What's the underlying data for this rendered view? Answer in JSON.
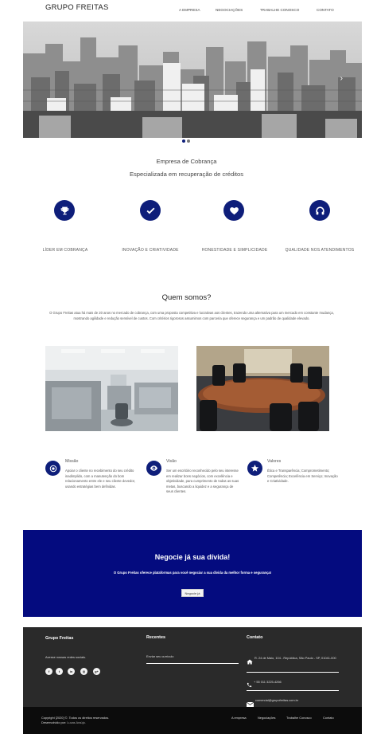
{
  "header": {
    "brand": "GRUPO FREITAS",
    "nav": [
      "A EMPRESA",
      "NEGOCIAÇÕES",
      "TRABALHE CONOSCO",
      "CONTATO"
    ]
  },
  "hero": {
    "alt": "city-skyline-photo"
  },
  "intro": {
    "line1": "Empresa de Cobrança",
    "line2": "Especializada em recuperação de créditos"
  },
  "features": [
    {
      "icon": "trophy-icon",
      "label": "LÍDER EM COBRANÇA"
    },
    {
      "icon": "check-icon",
      "label": "INOVAÇÃO E CRIATIVIDADE"
    },
    {
      "icon": "heart-icon",
      "label": "HONESTIDADE E SIMPLICIDADE"
    },
    {
      "icon": "headset-icon",
      "label": "QUALIDADE NOS ATENDIMENTOS"
    }
  ],
  "about": {
    "title": "Quem somos?",
    "text": "O Grupo Freitas atua há mais de 20 anos no mercado de cobrança, com uma proposta competitiva e lucrativas aos clientes, trazendo uma alternativa para um mercado em constante mudança, mostrando agilidade e redução sensível de custos. Com critérios rigorosos assumimos com parceria que oferece segurança e um padrão de qualidade elevado."
  },
  "mvv": [
    {
      "icon": "target-icon",
      "title": "Missão",
      "text": "Apoiar o cliente no recebimento do seu crédito inadimplido, com a manutenção do bom relacionamento entre ele e seu cliente devedor, usando estratégias bem definidas."
    },
    {
      "icon": "eye-icon",
      "title": "Visão",
      "text": "Ser um escritório reconhecido pelo seu interesse em realizar bons negócios, com excelência e objetividade, para cumprimento de todas as suas metas, buscando a liquidez e a segurança de seus clientes."
    },
    {
      "icon": "star-icon",
      "title": "Valores",
      "text": "Ética e Transparência; Comprometimento; Competência; Excelência em Serviço; Inovação e Criatividade."
    }
  ],
  "cta": {
    "title": "Negocie já sua dívida!",
    "subtitle": "O Grupo Freitas oferece plataformas para você negociar a sua dívida da melhor forma e segurança!",
    "button": "Negocie já"
  },
  "footer": {
    "brand": "Grupo Freitas",
    "follow": "Acesse nossas redes sociais.",
    "social": [
      "f",
      "t",
      "in",
      "◎",
      "g+"
    ],
    "recent_title": "Recentes",
    "recent_link": "Enviar seu currículo",
    "contact_title": "Contato",
    "address": "R. 24 de Maio, 104 - República, São Paulo - SP, 01041-000",
    "phone": "+ 55 011 3225-4266",
    "email": "comercial@grupofreitas.com.br"
  },
  "bottom": {
    "copyright": "Copyright [2020] ©. Todos os direitos reservados.",
    "developed_label": "Desenvolvido por:",
    "developed_name": "Lucas Araújo.",
    "links": [
      "A empresa",
      "Negociações",
      "Trabalhe Conosco",
      "Contato"
    ]
  },
  "colors": {
    "brand_blue": "#0e1e7a",
    "cta_blue": "#040b7f",
    "footer_bg": "#2a2a2a",
    "bottom_bg": "#0c0c0c"
  }
}
